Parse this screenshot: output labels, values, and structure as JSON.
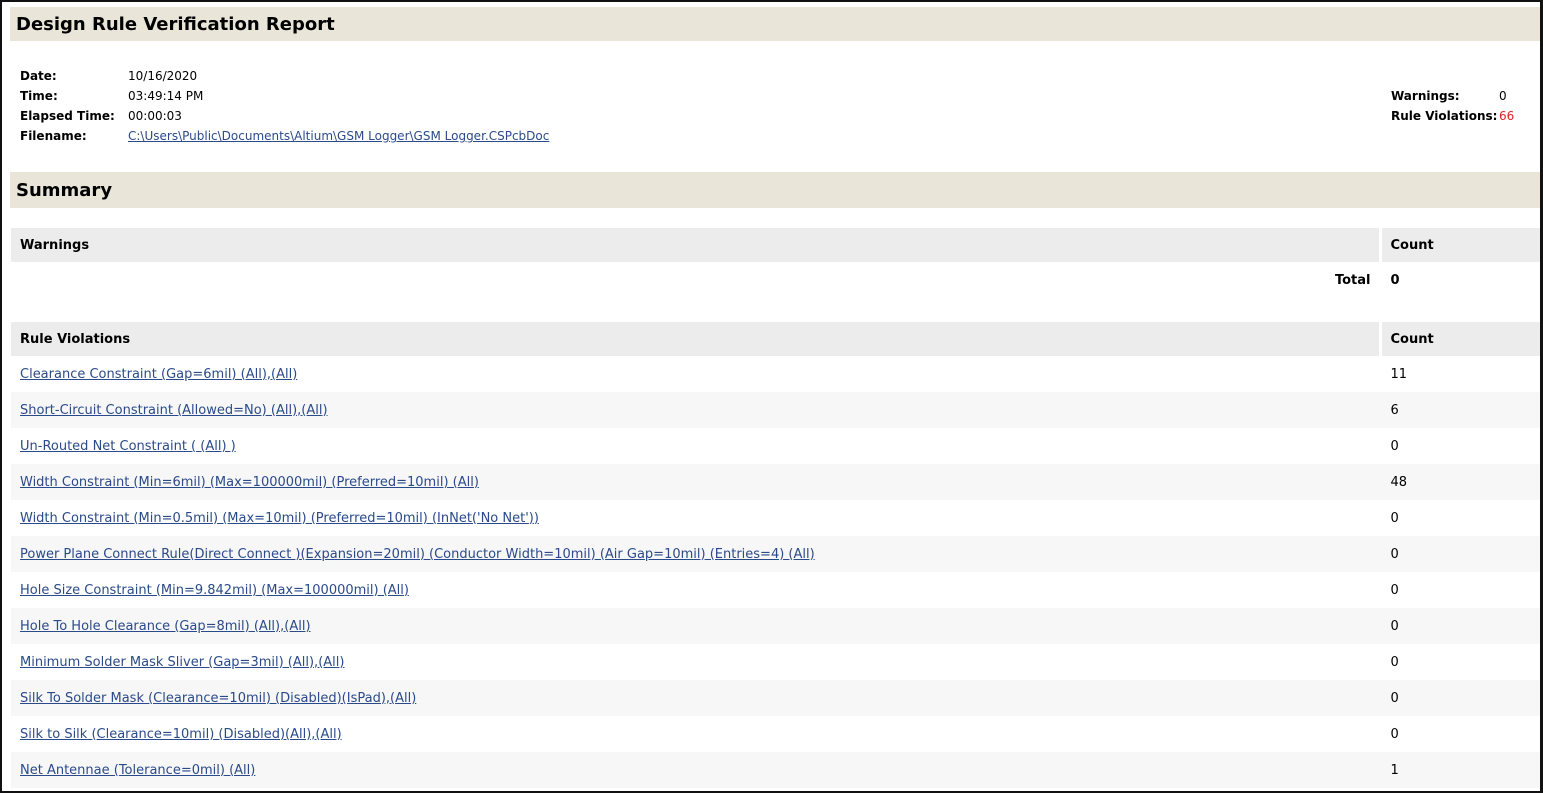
{
  "title": "Design Rule Verification Report",
  "info": {
    "date_label": "Date:",
    "date": "10/16/2020",
    "time_label": "Time:",
    "time": "03:49:14 PM",
    "elapsed_label": "Elapsed Time:",
    "elapsed": "00:00:03",
    "filename_label": "Filename:",
    "filename": "C:\\Users\\Public\\Documents\\Altium\\GSM Logger\\GSM Logger.CSPcbDoc"
  },
  "totals": {
    "warnings_label": "Warnings:",
    "warnings": "0",
    "violations_label": "Rule Violations:",
    "violations": "66",
    "violation_color": "#e02020"
  },
  "summary_title": "Summary",
  "warnings_table": {
    "header": "Warnings",
    "count_header": "Count",
    "total_label": "Total",
    "total": "0"
  },
  "violations_table": {
    "header": "Rule Violations",
    "count_header": "Count",
    "rows": [
      {
        "rule": "Clearance Constraint (Gap=6mil) (All),(All)",
        "count": "11"
      },
      {
        "rule": "Short-Circuit Constraint (Allowed=No) (All),(All)",
        "count": "6"
      },
      {
        "rule": "Un-Routed Net Constraint ( (All) )",
        "count": "0"
      },
      {
        "rule": "Width Constraint (Min=6mil) (Max=100000mil) (Preferred=10mil) (All)",
        "count": "48"
      },
      {
        "rule": "Width Constraint (Min=0.5mil) (Max=10mil) (Preferred=10mil) (InNet('No Net'))",
        "count": "0"
      },
      {
        "rule": "Power Plane Connect Rule(Direct Connect )(Expansion=20mil) (Conductor Width=10mil) (Air Gap=10mil) (Entries=4) (All)",
        "count": "0"
      },
      {
        "rule": "Hole Size Constraint (Min=9.842mil) (Max=100000mil) (All)",
        "count": "0"
      },
      {
        "rule": "Hole To Hole Clearance (Gap=8mil) (All),(All)",
        "count": "0"
      },
      {
        "rule": "Minimum Solder Mask Sliver (Gap=3mil) (All),(All)",
        "count": "0"
      },
      {
        "rule": "Silk To Solder Mask (Clearance=10mil) (Disabled)(IsPad),(All)",
        "count": "0"
      },
      {
        "rule": "Silk to Silk (Clearance=10mil) (Disabled)(All),(All)",
        "count": "0"
      },
      {
        "rule": "Net Antennae (Tolerance=0mil) (All)",
        "count": "1"
      }
    ]
  }
}
